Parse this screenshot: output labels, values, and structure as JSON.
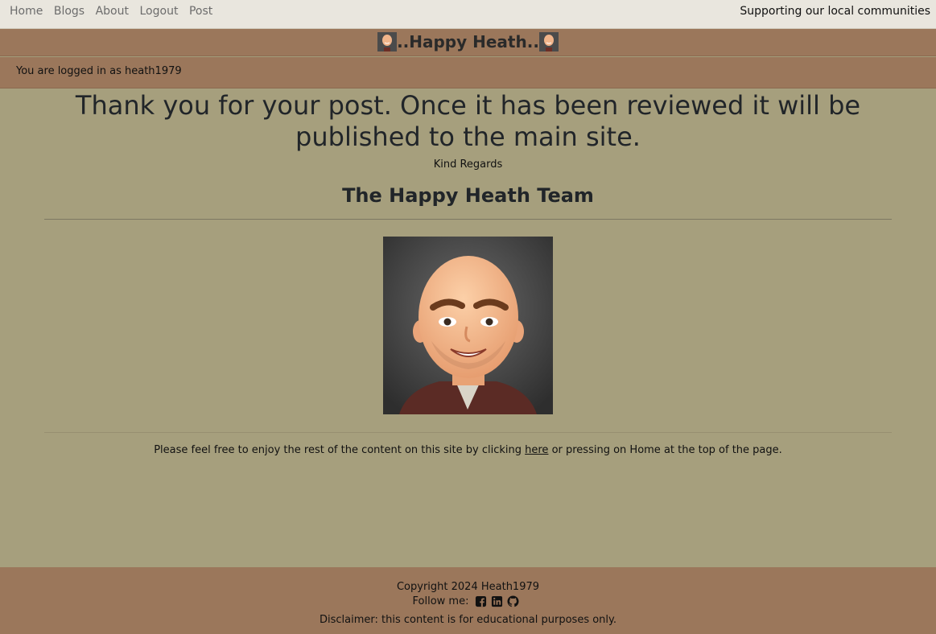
{
  "nav": {
    "links": [
      "Home",
      "Blogs",
      "About",
      "Logout",
      "Post"
    ],
    "tagline": "Supporting our local communities"
  },
  "brand": {
    "title": "..Happy Heath..",
    "avatar_icon": "avatar-icon"
  },
  "session": {
    "logged_in_text": "You are logged in as heath1979"
  },
  "main": {
    "heading": "Thank you for your post. Once it has been reviewed it will be published to the main site.",
    "sign_off": "Kind Regards",
    "team": "The Happy Heath Team",
    "enjoy_before": "Please feel free to enjoy the rest of the content on this site by clicking ",
    "enjoy_link": "here",
    "enjoy_after": " or pressing on Home at the top of the page."
  },
  "footer": {
    "copyright": "Copyright 2024 Heath1979",
    "follow_label": "Follow me:",
    "social_icons": [
      "facebook-icon",
      "linkedin-icon",
      "github-icon"
    ],
    "disclaimer": "Disclaimer: this content is for educational purposes only."
  },
  "colors": {
    "page_bg": "#a69f7d",
    "header_bg": "#9b775b",
    "topnav_bg": "#e9e6de"
  }
}
